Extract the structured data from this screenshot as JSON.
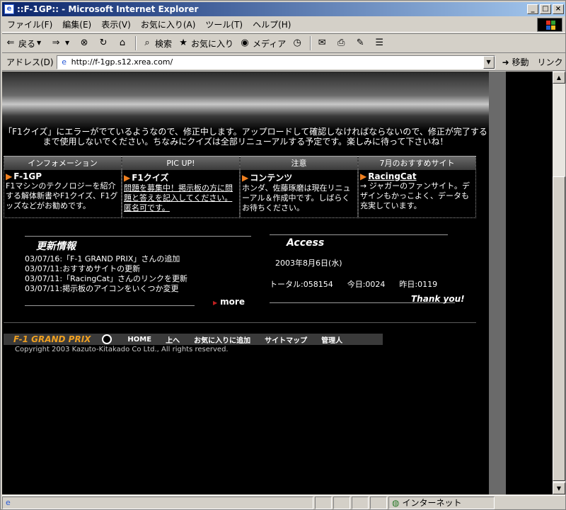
{
  "window": {
    "title": "::F-1GP:: - Microsoft Internet Explorer",
    "btn_min": "_",
    "btn_max": "□",
    "btn_close": "×"
  },
  "menu": [
    "ファイル(F)",
    "編集(E)",
    "表示(V)",
    "お気に入り(A)",
    "ツール(T)",
    "ヘルプ(H)"
  ],
  "toolbar": {
    "back": "戻る",
    "search": "検索",
    "favorites": "お気に入り",
    "media": "メディア"
  },
  "address": {
    "label": "アドレス(D)",
    "url": "http://f-1gp.s12.xrea.com/",
    "go": "移動",
    "links": "リンク"
  },
  "page": {
    "notice": "「F1クイズ」にエラーがでているようなので、修正中します。アップロードして確認しなければならないので、修正が完了するまで使用しないでください。ちなみにクイズは全部リニューアルする予定です。楽しみに待って下さいね！",
    "columns": [
      {
        "header": "インフォメーション",
        "title": "F-1GP",
        "body": "F1マシンのテクノロジーを紹介する解体新書やF1クイズ、F1グッズなどがお勧めです。"
      },
      {
        "header": "PIC UP!",
        "title": "F1クイズ",
        "body": "問題を募集中！掲示板の方に問題と答えを記入してください。匿名可です。"
      },
      {
        "header": "注意",
        "title": "コンテンツ",
        "body": "ホンダ、佐藤琢磨は現在リニューアル＆作成中です。しばらくお待ちください。"
      },
      {
        "header": "7月のおすすめサイト",
        "title": "RacingCat",
        "body": "→ ジャガーのファンサイト。デザインもかっこよく、データも充実しています。"
      }
    ],
    "updates_title": "更新情報",
    "updates": [
      "03/07/16:「F-1 GRAND PRIX」さんの追加",
      "03/07/11:おすすめサイトの更新",
      "03/07/11:「RacingCat」さんのリンクを更新",
      "03/07/11:掲示板のアイコンをいくつか変更"
    ],
    "more": "more",
    "access_title": "Access",
    "access_date": "2003年8月6日(水)",
    "total": "トータル:058154",
    "today": "今日:0024",
    "yesterday": "昨日:0119",
    "thanks": "Thank you!",
    "footer_brand": "F-1 GRAND PRIX",
    "footer_nav": [
      "HOME",
      "上へ",
      "お気に入りに追加",
      "サイトマップ",
      "管理人"
    ],
    "copyright": "Copyright 2003 Kazuto-Kitakado Co Ltd., All rights reserved."
  },
  "status": {
    "zone": "インターネット"
  }
}
